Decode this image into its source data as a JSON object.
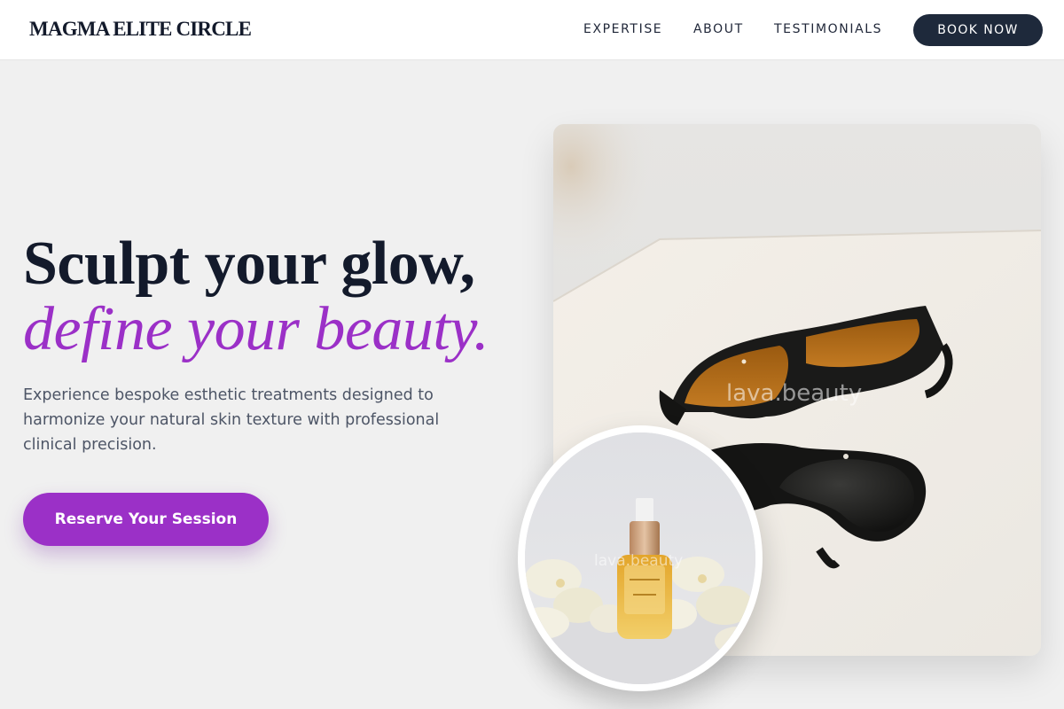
{
  "header": {
    "logo": "MAGMA ELITE CIRCLE",
    "nav": [
      {
        "label": "EXPERTISE"
      },
      {
        "label": "ABOUT"
      },
      {
        "label": "TESTIMONIALS"
      }
    ],
    "book_label": "BOOK NOW"
  },
  "hero": {
    "headline": "Sculpt your glow,",
    "headline_accent": "define your beauty.",
    "description": "Experience bespoke esthetic treatments designed to harmonize your natural skin texture with professional clinical precision.",
    "cta_label": "Reserve Your Session"
  },
  "images": {
    "main_watermark": "lava.beauty",
    "circle_watermark": "lava.beauty"
  },
  "colors": {
    "accent": "#9b30c7",
    "navy": "#1e293b",
    "background": "#f0f0f0",
    "text_muted": "#4d5566"
  },
  "icons": {
    "main_photo": "protective-goggles-photo",
    "circle_photo": "serum-bottle-photo"
  }
}
